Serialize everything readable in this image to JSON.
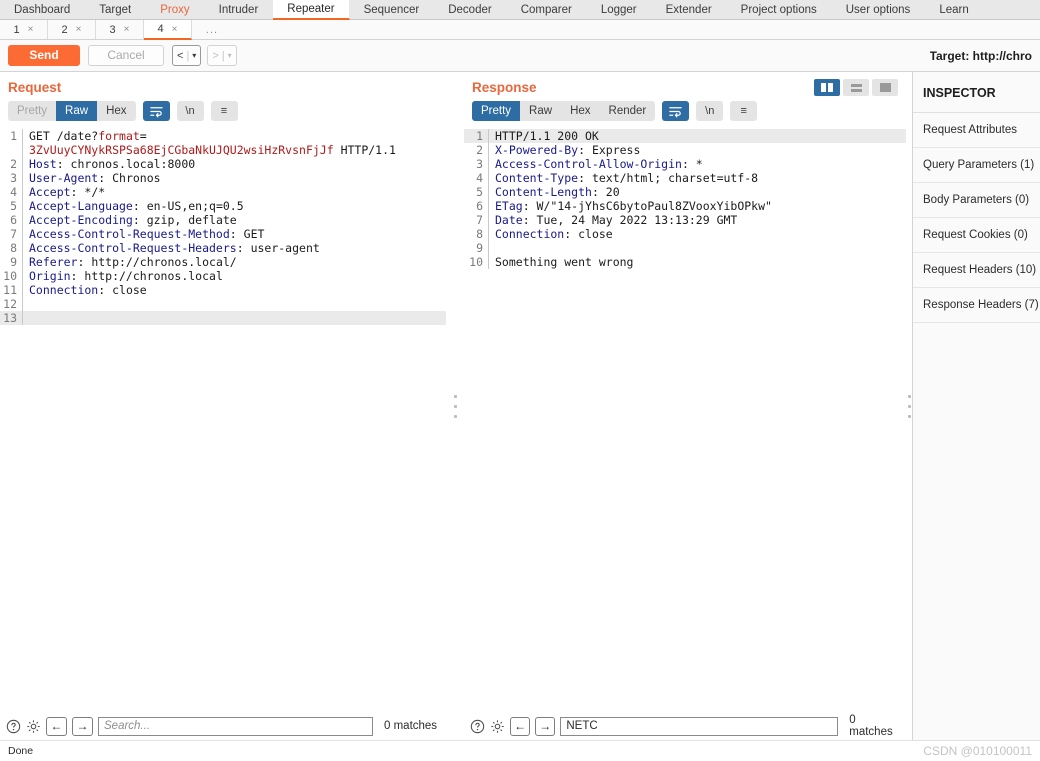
{
  "main_tabs": [
    {
      "label": "Dashboard",
      "state": "normal"
    },
    {
      "label": "Target",
      "state": "normal"
    },
    {
      "label": "Proxy",
      "state": "highlight"
    },
    {
      "label": "Intruder",
      "state": "normal"
    },
    {
      "label": "Repeater",
      "state": "active"
    },
    {
      "label": "Sequencer",
      "state": "normal"
    },
    {
      "label": "Decoder",
      "state": "normal"
    },
    {
      "label": "Comparer",
      "state": "normal"
    },
    {
      "label": "Logger",
      "state": "normal"
    },
    {
      "label": "Extender",
      "state": "normal"
    },
    {
      "label": "Project options",
      "state": "normal"
    },
    {
      "label": "User options",
      "state": "normal"
    },
    {
      "label": "Learn",
      "state": "normal"
    }
  ],
  "repeater_tabs": [
    {
      "label": "1",
      "close": "×",
      "active": false
    },
    {
      "label": "2",
      "close": "×",
      "active": false
    },
    {
      "label": "3",
      "close": "×",
      "active": false
    },
    {
      "label": "4",
      "close": "×",
      "active": true
    }
  ],
  "repeater_tabs_overflow": "...",
  "actions": {
    "send_label": "Send",
    "cancel_label": "Cancel",
    "back_label": "<",
    "back_caret": "▾",
    "forward_label": ">",
    "forward_caret": "▾",
    "target_label": "Target: http://chro"
  },
  "request": {
    "title": "Request",
    "view_tabs": [
      {
        "label": "Pretty",
        "state": "disabled"
      },
      {
        "label": "Raw",
        "state": "selected"
      },
      {
        "label": "Hex",
        "state": "normal"
      }
    ],
    "wrap_icon": "wrap-lines-icon",
    "newline_label": "\\n",
    "menu_label": "≡",
    "lines": [
      {
        "n": "1",
        "tall": true,
        "segments": [
          {
            "t": "GET /date?format=",
            "c": "v",
            "mixed": true
          },
          {
            "t": "3ZvUuyCYNykRSPSa68EjCGbaNkUJQU2wsiHzRvsnFjJf",
            "c": "p"
          },
          {
            "t": " HTTP/1.1",
            "c": "v"
          }
        ]
      },
      {
        "n": "2",
        "segments": [
          {
            "t": "Host",
            "c": "k"
          },
          {
            "t": ": chronos.local:8000",
            "c": "v"
          }
        ]
      },
      {
        "n": "3",
        "segments": [
          {
            "t": "User-Agent",
            "c": "k"
          },
          {
            "t": ": Chronos",
            "c": "v"
          }
        ]
      },
      {
        "n": "4",
        "segments": [
          {
            "t": "Accept",
            "c": "k"
          },
          {
            "t": ": */*",
            "c": "v"
          }
        ]
      },
      {
        "n": "5",
        "segments": [
          {
            "t": "Accept-Language",
            "c": "k"
          },
          {
            "t": ": en-US,en;q=0.5",
            "c": "v"
          }
        ]
      },
      {
        "n": "6",
        "segments": [
          {
            "t": "Accept-Encoding",
            "c": "k"
          },
          {
            "t": ": gzip, deflate",
            "c": "v"
          }
        ]
      },
      {
        "n": "7",
        "segments": [
          {
            "t": "Access-Control-Request-Method",
            "c": "k"
          },
          {
            "t": ": GET",
            "c": "v"
          }
        ]
      },
      {
        "n": "8",
        "segments": [
          {
            "t": "Access-Control-Request-Headers",
            "c": "k"
          },
          {
            "t": ": user-agent",
            "c": "v"
          }
        ]
      },
      {
        "n": "9",
        "segments": [
          {
            "t": "Referer",
            "c": "k"
          },
          {
            "t": ": http://chronos.local/",
            "c": "v"
          }
        ]
      },
      {
        "n": "10",
        "segments": [
          {
            "t": "Origin",
            "c": "k"
          },
          {
            "t": ": http://chronos.local",
            "c": "v"
          }
        ]
      },
      {
        "n": "11",
        "segments": [
          {
            "t": "Connection",
            "c": "k"
          },
          {
            "t": ": close",
            "c": "v"
          }
        ]
      },
      {
        "n": "12",
        "segments": []
      },
      {
        "n": "13",
        "segments": [],
        "highlight": true
      }
    ],
    "find": {
      "help_icon": "help-icon",
      "settings_icon": "gear-icon",
      "prev_label": "←",
      "next_label": "→",
      "value": "",
      "placeholder": "Search...",
      "matches": "0 matches"
    }
  },
  "response": {
    "title": "Response",
    "view_tabs": [
      {
        "label": "Pretty",
        "state": "selected"
      },
      {
        "label": "Raw",
        "state": "normal"
      },
      {
        "label": "Hex",
        "state": "normal"
      },
      {
        "label": "Render",
        "state": "normal"
      }
    ],
    "wrap_icon": "wrap-lines-icon",
    "newline_label": "\\n",
    "menu_label": "≡",
    "layout_toggles": [
      {
        "name": "side-by-side-layout",
        "selected": true
      },
      {
        "name": "stacked-layout",
        "selected": false
      },
      {
        "name": "single-pane-layout",
        "selected": false
      }
    ],
    "lines": [
      {
        "n": "1",
        "highlight": true,
        "segments": [
          {
            "t": "HTTP/1.1 200 OK",
            "c": "v"
          }
        ]
      },
      {
        "n": "2",
        "segments": [
          {
            "t": "X-Powered-By",
            "c": "k"
          },
          {
            "t": ": Express",
            "c": "v"
          }
        ]
      },
      {
        "n": "3",
        "segments": [
          {
            "t": "Access-Control-Allow-Origin",
            "c": "k"
          },
          {
            "t": ": *",
            "c": "v"
          }
        ]
      },
      {
        "n": "4",
        "segments": [
          {
            "t": "Content-Type",
            "c": "k"
          },
          {
            "t": ": text/html; charset=utf-8",
            "c": "v"
          }
        ]
      },
      {
        "n": "5",
        "segments": [
          {
            "t": "Content-Length",
            "c": "k"
          },
          {
            "t": ": 20",
            "c": "v"
          }
        ]
      },
      {
        "n": "6",
        "segments": [
          {
            "t": "ETag",
            "c": "k"
          },
          {
            "t": ": W/\"14-jYhsC6bytoPaul8ZVooxYibOPkw\"",
            "c": "v"
          }
        ]
      },
      {
        "n": "7",
        "segments": [
          {
            "t": "Date",
            "c": "k"
          },
          {
            "t": ": Tue, 24 May 2022 13:13:29 GMT",
            "c": "v"
          }
        ]
      },
      {
        "n": "8",
        "segments": [
          {
            "t": "Connection",
            "c": "k"
          },
          {
            "t": ": close",
            "c": "v"
          }
        ]
      },
      {
        "n": "9",
        "segments": []
      },
      {
        "n": "10",
        "segments": [
          {
            "t": "Something went wrong",
            "c": "v"
          }
        ]
      }
    ],
    "find": {
      "help_icon": "help-icon",
      "settings_icon": "gear-icon",
      "prev_label": "←",
      "next_label": "→",
      "value": "NETC",
      "placeholder": "Search...",
      "matches": "0 matches"
    }
  },
  "inspector": {
    "title": "INSPECTOR",
    "items": [
      {
        "label": "Request Attributes"
      },
      {
        "label": "Query Parameters (1)"
      },
      {
        "label": "Body Parameters (0)"
      },
      {
        "label": "Request Cookies (0)"
      },
      {
        "label": "Request Headers (10)"
      },
      {
        "label": "Response Headers (7)"
      }
    ]
  },
  "status": {
    "text": "Done",
    "watermark": "CSDN @010100011"
  },
  "colors": {
    "accent": "#f26722",
    "send": "#fb6b33",
    "selected_tab": "#2e6da4",
    "header_key": "#18198c",
    "param_value": "#b01a1a"
  }
}
